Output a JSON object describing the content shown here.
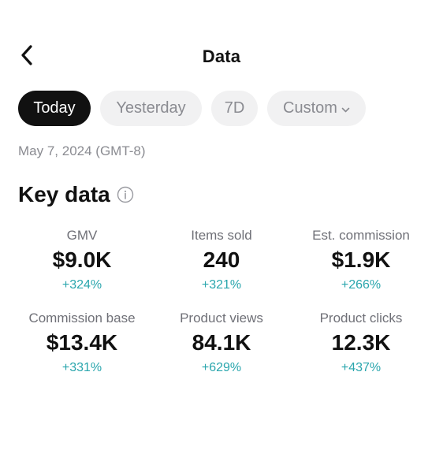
{
  "header": {
    "title": "Data",
    "back_icon": "chevron-left-icon"
  },
  "tabs": [
    {
      "label": "Today",
      "active": true
    },
    {
      "label": "Yesterday",
      "active": false
    },
    {
      "label": "7D",
      "active": false
    },
    {
      "label": "Custom",
      "active": false,
      "icon": "chevron-down-icon"
    }
  ],
  "date_range": "May 7, 2024 (GMT-8)",
  "key_data": {
    "title": "Key data",
    "info_icon": "info-icon",
    "metrics": [
      {
        "label": "GMV",
        "value": "$9.0K",
        "change": "+324%"
      },
      {
        "label": "Items sold",
        "value": "240",
        "change": "+321%"
      },
      {
        "label": "Est. commission",
        "value": "$1.9K",
        "change": "+266%"
      },
      {
        "label": "Commission base",
        "value": "$13.4K",
        "change": "+331%"
      },
      {
        "label": "Product views",
        "value": "84.1K",
        "change": "+629%"
      },
      {
        "label": "Product clicks",
        "value": "12.3K",
        "change": "+437%"
      }
    ]
  },
  "colors": {
    "accent_positive": "#2aa6ad",
    "active_tab_bg": "#111111",
    "inactive_tab_bg": "#f1f1f2",
    "muted_text": "#8a8b91"
  }
}
